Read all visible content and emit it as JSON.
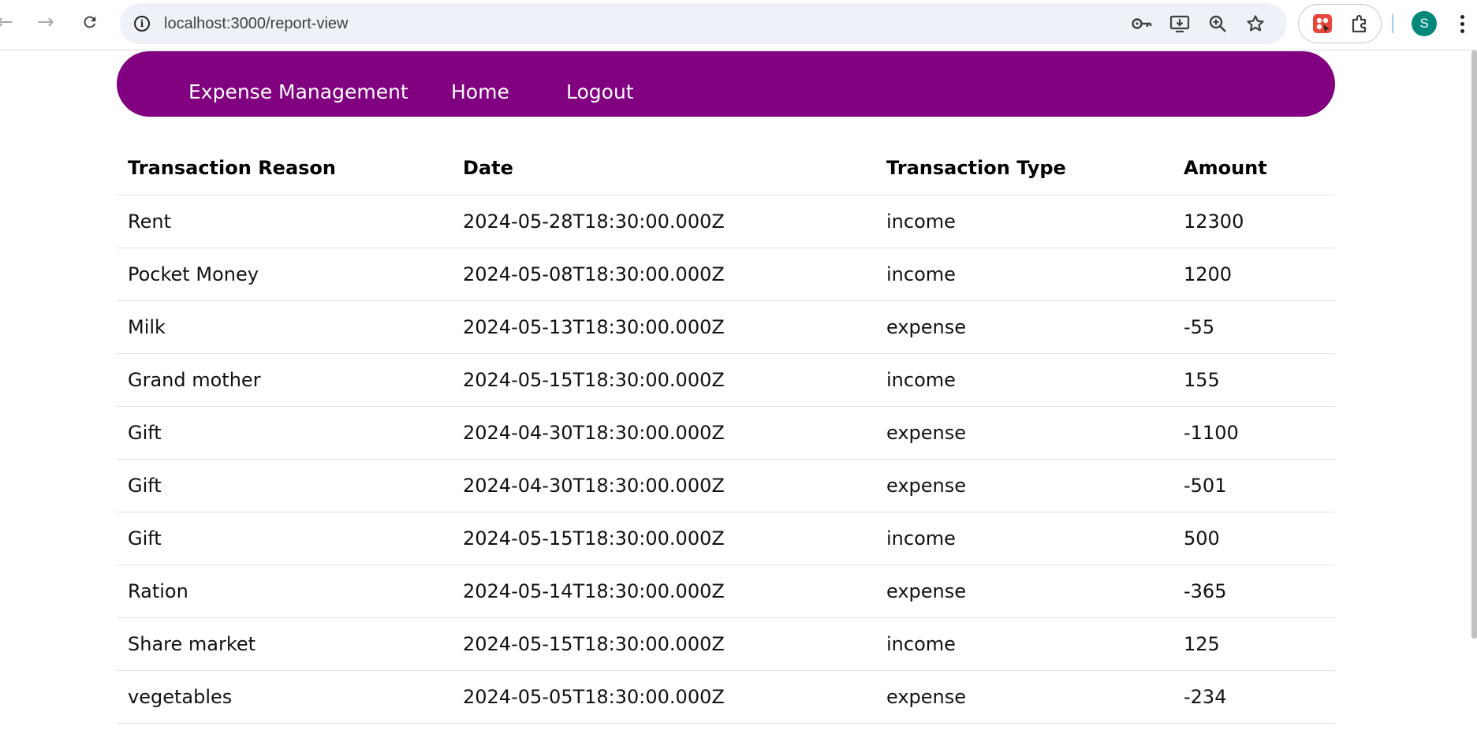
{
  "browser": {
    "url": "localhost:3000/report-view",
    "profile_initial": "S"
  },
  "navbar": {
    "brand": "Expense Management",
    "links": [
      "Home",
      "Logout"
    ]
  },
  "table": {
    "headers": [
      "Transaction Reason",
      "Date",
      "Transaction Type",
      "Amount"
    ],
    "rows": [
      {
        "reason": "Rent",
        "date": "2024-05-28T18:30:00.000Z",
        "type": "income",
        "amount": "12300"
      },
      {
        "reason": "Pocket Money",
        "date": "2024-05-08T18:30:00.000Z",
        "type": "income",
        "amount": "1200"
      },
      {
        "reason": "Milk",
        "date": "2024-05-13T18:30:00.000Z",
        "type": "expense",
        "amount": "-55"
      },
      {
        "reason": "Grand mother",
        "date": "2024-05-15T18:30:00.000Z",
        "type": "income",
        "amount": "155"
      },
      {
        "reason": "Gift",
        "date": "2024-04-30T18:30:00.000Z",
        "type": "expense",
        "amount": "-1100"
      },
      {
        "reason": "Gift",
        "date": "2024-04-30T18:30:00.000Z",
        "type": "expense",
        "amount": "-501"
      },
      {
        "reason": "Gift",
        "date": "2024-05-15T18:30:00.000Z",
        "type": "income",
        "amount": "500"
      },
      {
        "reason": "Ration",
        "date": "2024-05-14T18:30:00.000Z",
        "type": "expense",
        "amount": "-365"
      },
      {
        "reason": "Share market",
        "date": "2024-05-15T18:30:00.000Z",
        "type": "income",
        "amount": "125"
      },
      {
        "reason": "vegetables",
        "date": "2024-05-05T18:30:00.000Z",
        "type": "expense",
        "amount": "-234"
      }
    ]
  },
  "colors": {
    "navbar_bg": "#800080",
    "income_green": "#008000",
    "expense_red": "#ff0000",
    "avatar_teal": "#00897b"
  }
}
